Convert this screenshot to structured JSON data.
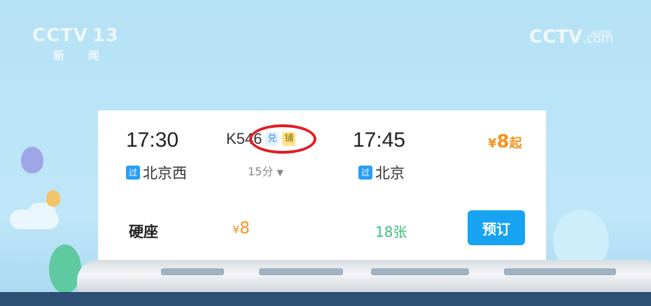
{
  "watermark_left": {
    "brand": "CCTV",
    "channel": "13",
    "sub": "新 闻"
  },
  "watermark_right": {
    "brand": "CCTV",
    "small": "央视网",
    "suffix": ".com"
  },
  "ticket": {
    "depart_time": "17:30",
    "depart_badge": "过",
    "depart_station": "北京西",
    "train_no": "K546",
    "tag_exchange": "兑",
    "tag_berth": "铺",
    "duration": "15分",
    "duration_icon": "caret-down-icon",
    "arrive_time": "17:45",
    "arrive_badge": "过",
    "arrive_station": "北京",
    "price_from_symbol": "¥",
    "price_from_value": "8",
    "price_from_suffix": "起",
    "seat_type": "硬座",
    "seat_price_symbol": "¥",
    "seat_price_value": "8",
    "tickets_left": "18张",
    "book_label": "预订"
  },
  "colors": {
    "accent": "#17a3f2",
    "price": "#f7931e",
    "tickets": "#3cc07a",
    "highlight_ring": "#e31b23"
  }
}
